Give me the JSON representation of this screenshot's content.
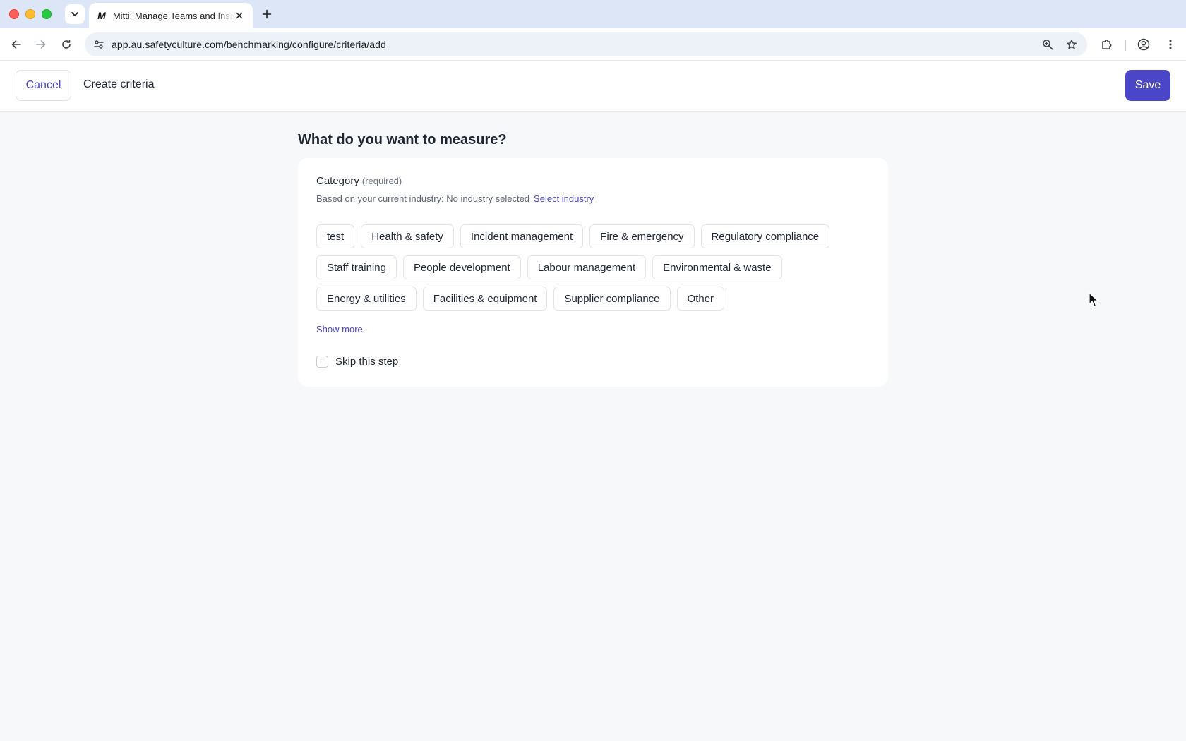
{
  "browser": {
    "tab_title": "Mitti: Manage Teams and Inspections",
    "tab_favicon": "M",
    "url": "app.au.safetyculture.com/benchmarking/configure/criteria/add",
    "icons": {
      "tab_list": "chevron-down-icon",
      "close": "close-icon",
      "new_tab": "plus-icon",
      "back": "arrow-left-icon",
      "forward": "arrow-right-icon",
      "reload": "reload-icon",
      "site_info": "tune-icon",
      "zoom": "zoom-in-icon",
      "bookmark": "star-icon",
      "extensions": "puzzle-icon",
      "profile": "account-circle-icon",
      "menu": "more-vertical-icon"
    }
  },
  "header": {
    "cancel_label": "Cancel",
    "title": "Create criteria",
    "save_label": "Save"
  },
  "main": {
    "question": "What do you want to measure?",
    "category": {
      "label": "Category",
      "required": "(required)",
      "industry_text": "Based on your current industry: No industry selected",
      "select_industry": "Select industry",
      "chip_rows": [
        [
          "test",
          "Health & safety",
          "Incident management",
          "Fire & emergency",
          "Regulatory compliance"
        ],
        [
          "Staff training",
          "People development",
          "Labour management",
          "Environmental & waste"
        ],
        [
          "Energy & utilities",
          "Facilities & equipment",
          "Supplier compliance",
          "Other"
        ]
      ],
      "show_more": "Show more"
    },
    "skip_label": "Skip this step"
  },
  "colors": {
    "accent": "#4b45c8",
    "link": "#4a44c6",
    "page_bg": "#f7f8fa",
    "tabstrip_bg": "#dde6f7"
  }
}
